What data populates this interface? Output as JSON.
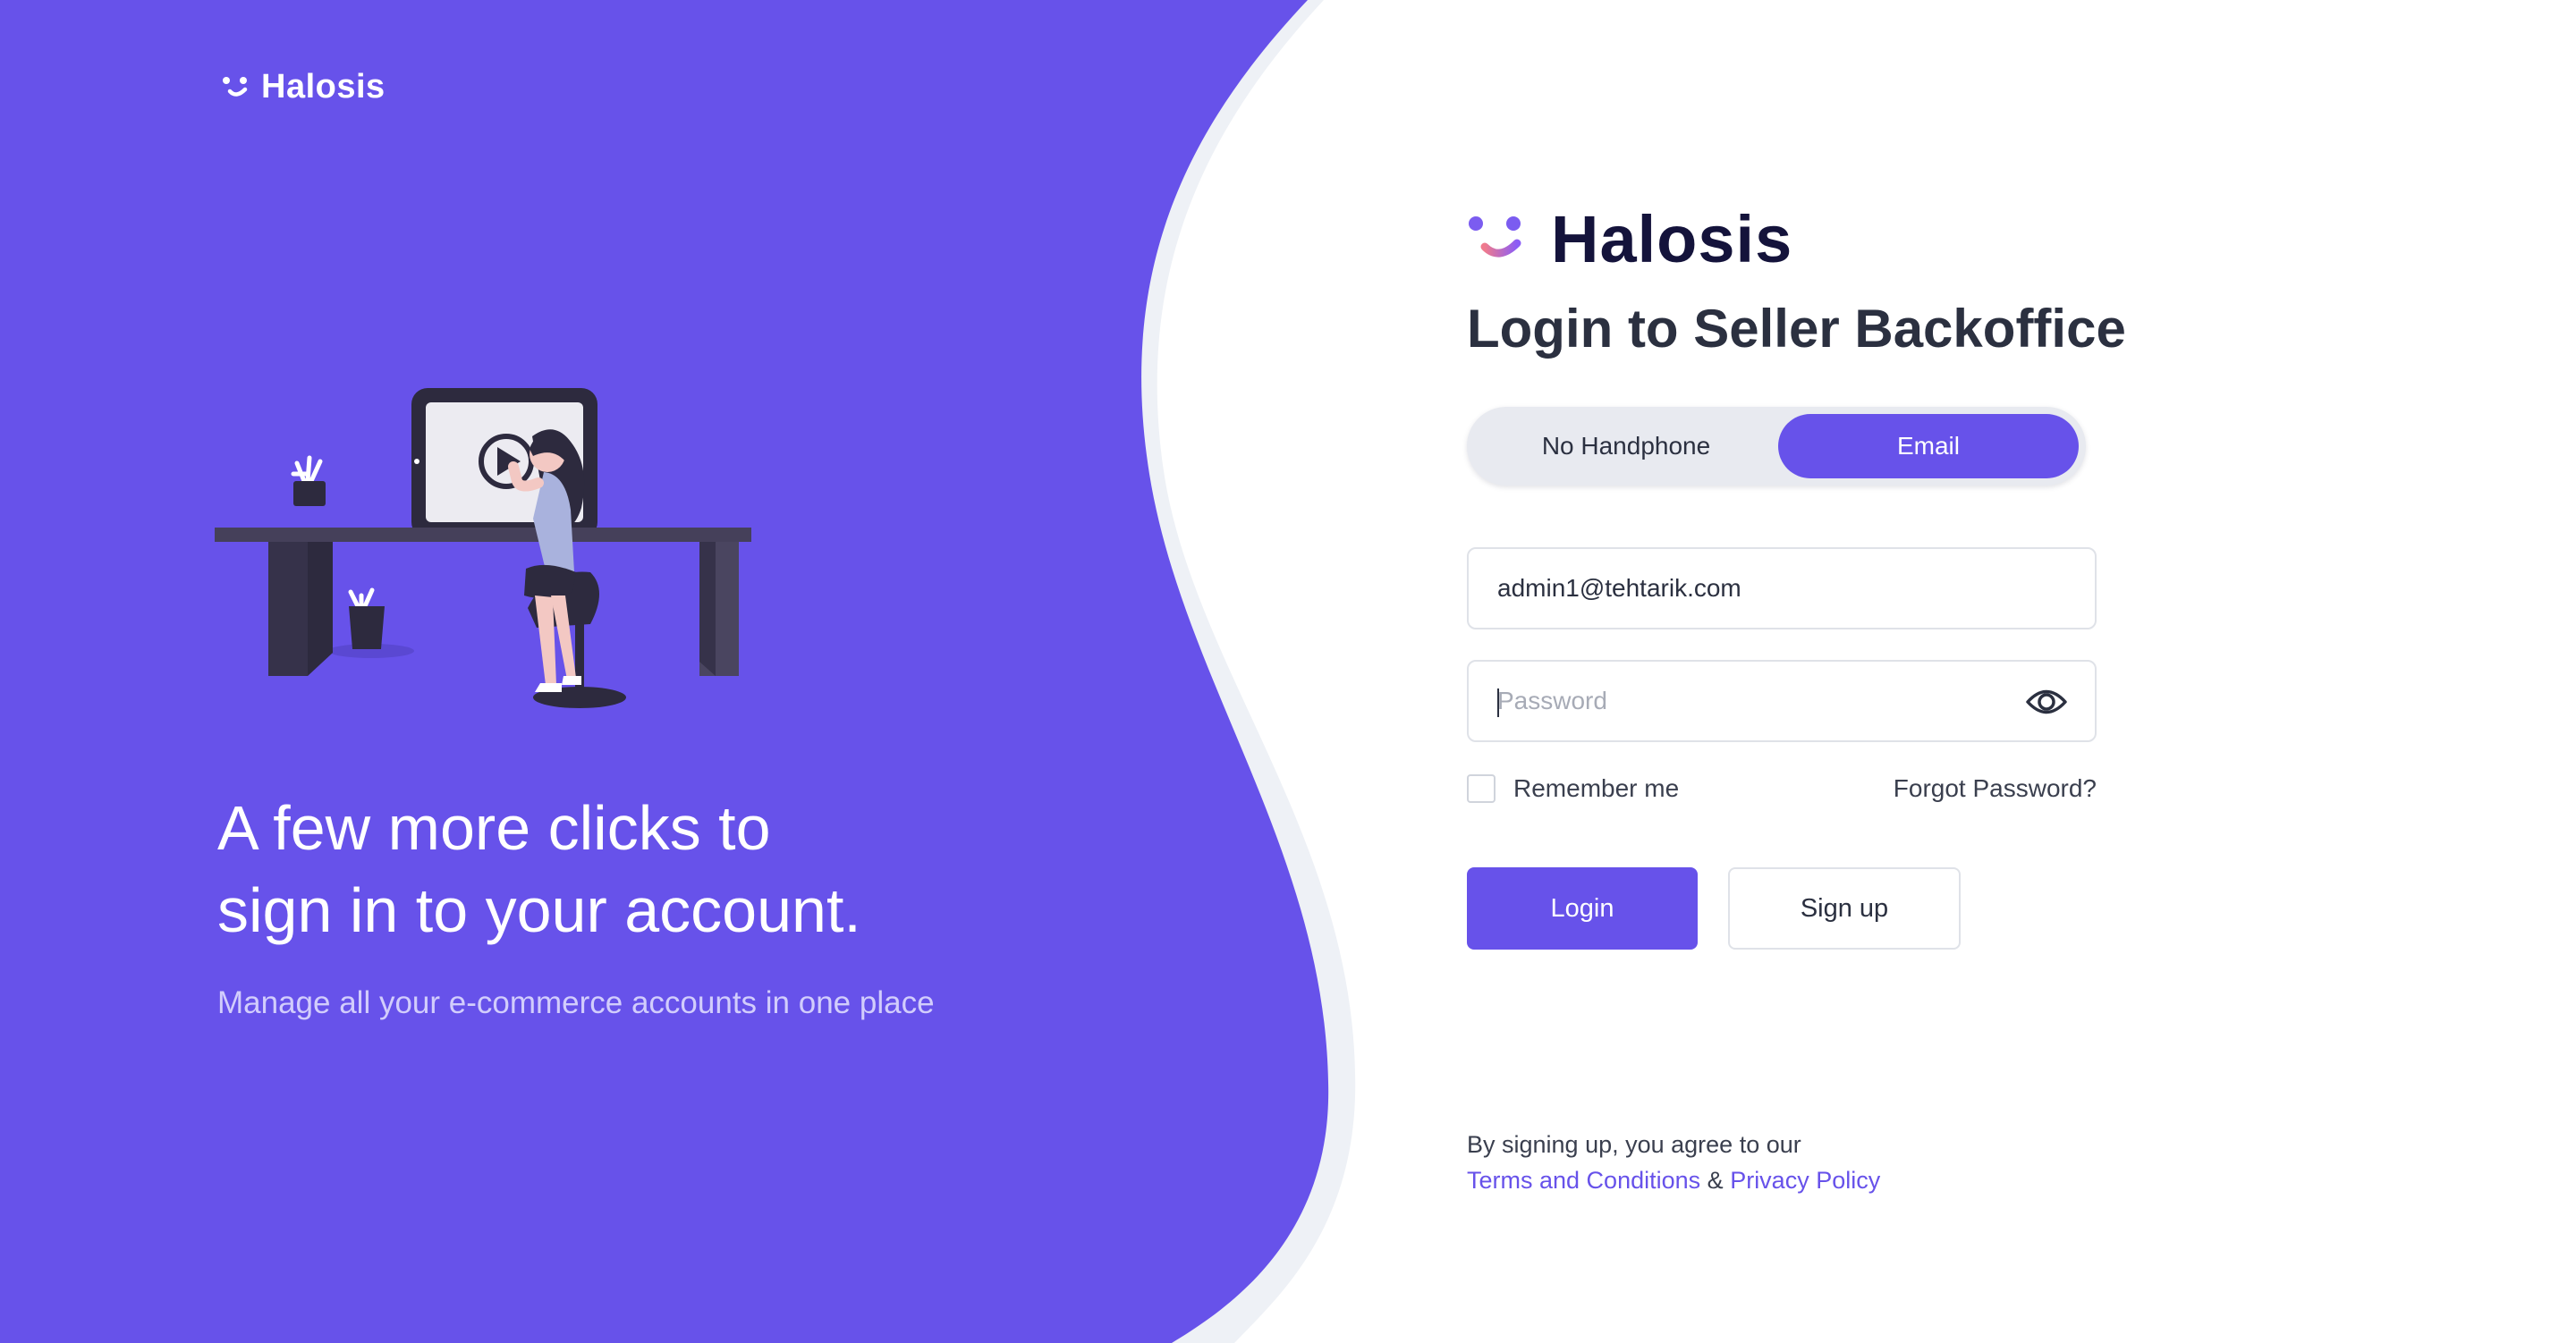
{
  "brand": {
    "name": "Halosis"
  },
  "left": {
    "headline_line1": "A few more clicks to",
    "headline_line2": "sign in to your account.",
    "subtitle": "Manage all your e-commerce accounts in one place"
  },
  "form": {
    "title": "Login to Seller Backoffice",
    "tabs": [
      {
        "label": "No Handphone",
        "active": false
      },
      {
        "label": "Email",
        "active": true
      }
    ],
    "email_value": "admin1@tehtarik.com",
    "password_placeholder": "Password",
    "remember_label": "Remember me",
    "forgot_label": "Forgot Password?",
    "login_label": "Login",
    "signup_label": "Sign up"
  },
  "footer": {
    "agree_text": "By signing up, you agree to our",
    "terms_label": "Terms and Conditions",
    "amp": "&",
    "privacy_label": "Privacy Policy"
  },
  "colors": {
    "primary": "#6752ea",
    "text_dark": "#2b3040",
    "brand_dark": "#14133b",
    "segment_bg": "#e8eaf0"
  },
  "icons": {
    "brand_logo": "smile-logo-icon",
    "password_toggle": "eye-icon",
    "illustration": "woman-at-desk-illustration"
  }
}
